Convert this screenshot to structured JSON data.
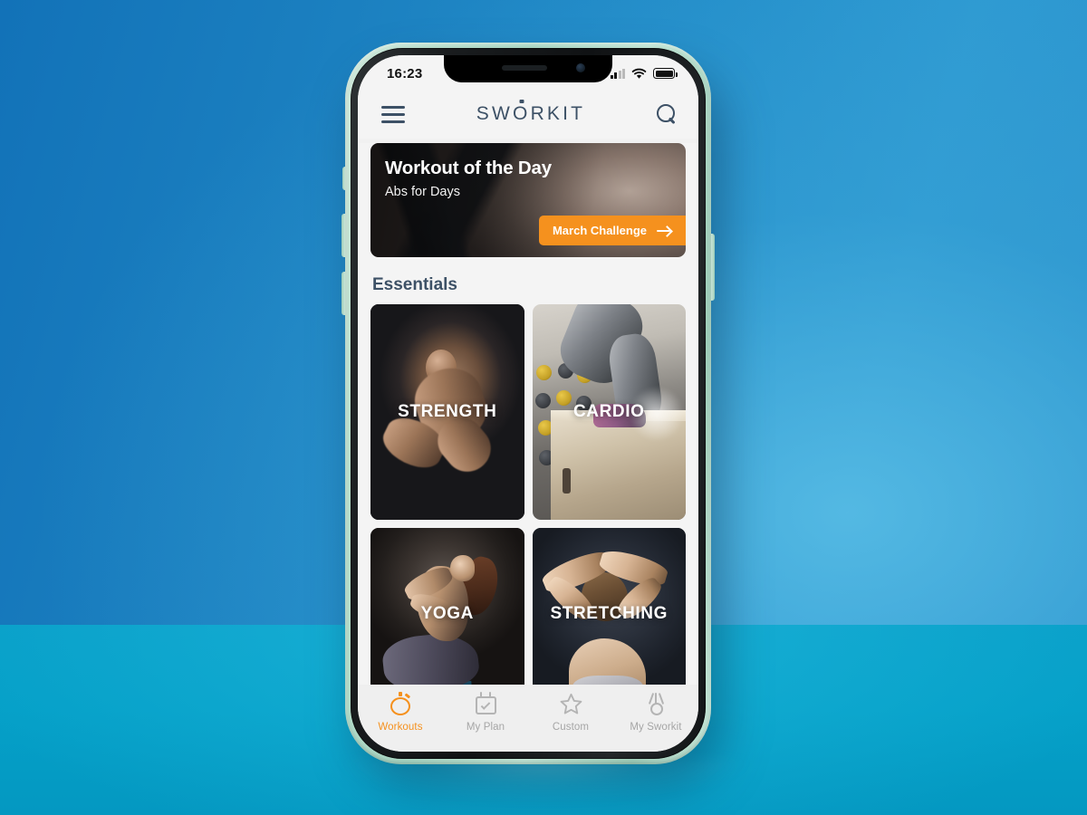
{
  "status_bar": {
    "time": "16:23",
    "signal_icon": "cellular-signal-icon",
    "wifi_icon": "wifi-icon",
    "battery_icon": "battery-full-icon"
  },
  "app_bar": {
    "menu_icon": "hamburger-menu-icon",
    "brand_part1": "SW",
    "brand_o": "O",
    "brand_part2": "RKIT",
    "brand_full": "SWORKIT",
    "search_icon": "search-icon"
  },
  "workout_of_the_day": {
    "title": "Workout of the Day",
    "subtitle": "Abs for Days",
    "cta_label": "March Challenge",
    "cta_icon": "arrow-right-icon",
    "cta_color": "#f5911e"
  },
  "essentials": {
    "section_title": "Essentials",
    "cards": [
      {
        "label": "STRENGTH"
      },
      {
        "label": "CARDIO"
      },
      {
        "label": "YOGA"
      },
      {
        "label": "STRETCHING"
      }
    ]
  },
  "tab_bar": {
    "active_color": "#f5911e",
    "inactive_color": "#a6a6a6",
    "tabs": [
      {
        "label": "Workouts",
        "icon": "stopwatch-icon",
        "active": true
      },
      {
        "label": "My Plan",
        "icon": "calendar-check-icon",
        "active": false
      },
      {
        "label": "Custom",
        "icon": "star-icon",
        "active": false
      },
      {
        "label": "My Sworkit",
        "icon": "medal-icon",
        "active": false
      }
    ]
  },
  "theme": {
    "brand_navy": "#3d5166",
    "accent_orange": "#f5911e",
    "background_blue": "#1b80c0",
    "floor_teal": "#09a0c9",
    "phone_frame": "#b6ddcb"
  }
}
